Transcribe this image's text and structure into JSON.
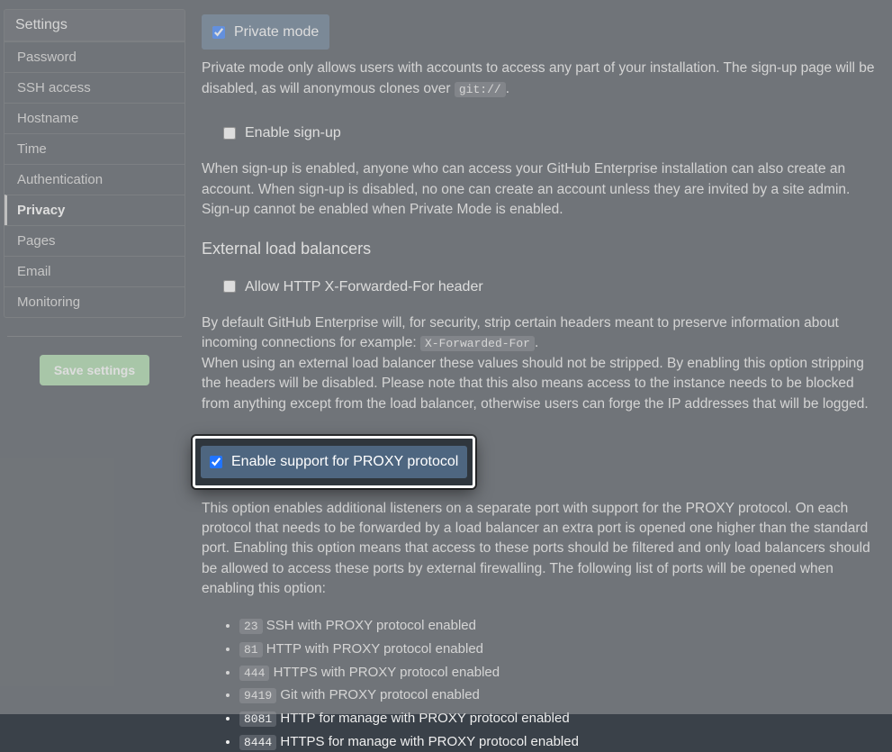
{
  "sidebar": {
    "title": "Settings",
    "items": [
      {
        "label": "Password"
      },
      {
        "label": "SSH access"
      },
      {
        "label": "Hostname"
      },
      {
        "label": "Time"
      },
      {
        "label": "Authentication"
      },
      {
        "label": "Privacy"
      },
      {
        "label": "Pages"
      },
      {
        "label": "Email"
      },
      {
        "label": "Monitoring"
      }
    ],
    "save_label": "Save settings"
  },
  "privacy": {
    "private_mode_label": "Private mode",
    "private_mode_desc_1": "Private mode only allows users with accounts to access any part of your installation. The sign-up page will be disabled, as will anonymous clones over ",
    "private_mode_code": "git://",
    "private_mode_desc_2": ".",
    "signup_label": "Enable sign-up",
    "signup_desc": "When sign-up is enabled, anyone who can access your GitHub Enterprise installation can also create an account. When sign-up is disabled, no one can create an account unless they are invited by a site admin. Sign-up cannot be enabled when Private Mode is enabled."
  },
  "lb": {
    "heading": "External load balancers",
    "xff_label": "Allow HTTP X-Forwarded-For header",
    "xff_desc_1": "By default GitHub Enterprise will, for security, strip certain headers meant to preserve information about incoming connections for example: ",
    "xff_code": "X-Forwarded-For",
    "xff_desc_2": ".",
    "xff_desc_3": "When using an external load balancer these values should not be stripped. By enabling this option stripping the headers will be disabled. Please note that this also means access to the instance needs to be blocked from anything except from the load balancer, otherwise users can forge the IP addresses that will be logged.",
    "proxy_label": "Enable support for PROXY protocol",
    "proxy_desc": "This option enables additional listeners on a separate port with support for the PROXY protocol. On each protocol that needs to be forwarded by a load balancer an extra port is opened one higher than the standard port. Enabling this option means that access to these ports should be filtered and only load balancers should be allowed to access these ports by external firewalling. The following list of ports will be opened when enabling this option:",
    "ports": [
      {
        "port": "23",
        "text": "SSH with PROXY protocol enabled"
      },
      {
        "port": "81",
        "text": "HTTP with PROXY protocol enabled"
      },
      {
        "port": "444",
        "text": "HTTPS with PROXY protocol enabled"
      },
      {
        "port": "9419",
        "text": "Git with PROXY protocol enabled"
      },
      {
        "port": "8081",
        "text": "HTTP for manage with PROXY protocol enabled"
      },
      {
        "port": "8444",
        "text": "HTTPS for manage with PROXY protocol enabled"
      }
    ]
  }
}
